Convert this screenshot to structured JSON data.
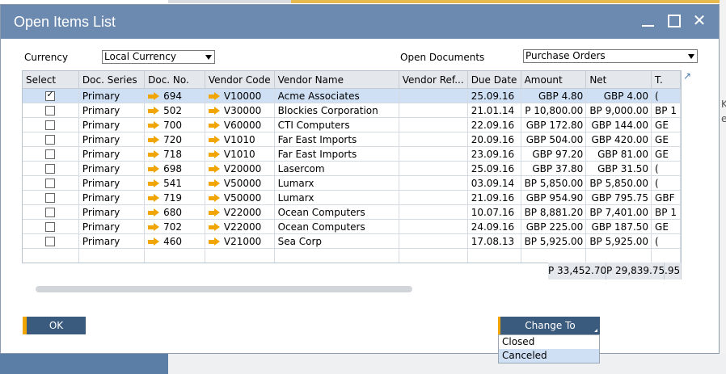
{
  "window": {
    "title": "Open Items List"
  },
  "filters": {
    "currency_label": "Currency",
    "currency_value": "Local Currency",
    "open_documents_label": "Open Documents",
    "open_documents_value": "Purchase Orders"
  },
  "table": {
    "columns": [
      "Select",
      "Doc. Series",
      "Doc. No.",
      "Vendor Code",
      "Vendor Name",
      "Vendor Ref...",
      "Due Date",
      "Amount",
      "Net",
      "T."
    ],
    "rows": [
      {
        "checked": true,
        "series": "Primary",
        "doc_no": "694",
        "vendor_code": "V10000",
        "vendor_name": "Acme Associates",
        "vendor_ref": "",
        "due_date": "25.09.16",
        "amount": "GBP 4.80",
        "net": "GBP 4.00",
        "t": "("
      },
      {
        "checked": false,
        "series": "Primary",
        "doc_no": "502",
        "vendor_code": "V30000",
        "vendor_name": "Blockies Corporation",
        "vendor_ref": "",
        "due_date": "21.01.14",
        "amount": "P 10,800.00",
        "net": "BP 9,000.00",
        "t": "BP 1"
      },
      {
        "checked": false,
        "series": "Primary",
        "doc_no": "700",
        "vendor_code": "V60000",
        "vendor_name": "CTI Computers",
        "vendor_ref": "",
        "due_date": "22.09.16",
        "amount": "GBP 172.80",
        "net": "GBP 144.00",
        "t": "GE"
      },
      {
        "checked": false,
        "series": "Primary",
        "doc_no": "720",
        "vendor_code": "V1010",
        "vendor_name": "Far East Imports",
        "vendor_ref": "",
        "due_date": "20.09.16",
        "amount": "GBP 504.00",
        "net": "GBP 420.00",
        "t": "GE"
      },
      {
        "checked": false,
        "series": "Primary",
        "doc_no": "718",
        "vendor_code": "V1010",
        "vendor_name": "Far East Imports",
        "vendor_ref": "",
        "due_date": "23.09.16",
        "amount": "GBP 97.20",
        "net": "GBP 81.00",
        "t": "GE"
      },
      {
        "checked": false,
        "series": "Primary",
        "doc_no": "698",
        "vendor_code": "V20000",
        "vendor_name": "Lasercom",
        "vendor_ref": "",
        "due_date": "25.09.16",
        "amount": "GBP 37.80",
        "net": "GBP 31.50",
        "t": "("
      },
      {
        "checked": false,
        "series": "Primary",
        "doc_no": "541",
        "vendor_code": "V50000",
        "vendor_name": "Lumarx",
        "vendor_ref": "",
        "due_date": "03.09.14",
        "amount": "BP 5,850.00",
        "net": "BP 5,850.00",
        "t": "("
      },
      {
        "checked": false,
        "series": "Primary",
        "doc_no": "719",
        "vendor_code": "V50000",
        "vendor_name": "Lumarx",
        "vendor_ref": "",
        "due_date": "21.09.16",
        "amount": "GBP 954.90",
        "net": "GBP 795.75",
        "t": "GBF"
      },
      {
        "checked": false,
        "series": "Primary",
        "doc_no": "680",
        "vendor_code": "V22000",
        "vendor_name": "Ocean Computers",
        "vendor_ref": "",
        "due_date": "10.07.16",
        "amount": "BP 8,881.20",
        "net": "BP 7,401.00",
        "t": "BP 1"
      },
      {
        "checked": false,
        "series": "Primary",
        "doc_no": "702",
        "vendor_code": "V22000",
        "vendor_name": "Ocean Computers",
        "vendor_ref": "",
        "due_date": "24.09.16",
        "amount": "GBP 225.00",
        "net": "GBP 187.50",
        "t": "GE"
      },
      {
        "checked": false,
        "series": "Primary",
        "doc_no": "460",
        "vendor_code": "V21000",
        "vendor_name": "Sea Corp",
        "vendor_ref": "",
        "due_date": "17.08.13",
        "amount": "BP 5,925.00",
        "net": "BP 5,925.00",
        "t": "("
      }
    ],
    "totals": {
      "amount": "P 33,452.70",
      "net": "P 29,839.75",
      "t": ".95"
    }
  },
  "buttons": {
    "ok_label": "OK",
    "change_to_label": "Change To"
  },
  "change_menu": {
    "items": [
      "Closed",
      "Canceled"
    ],
    "highlighted_index": 1
  },
  "background": {
    "right_text_1": "K",
    "right_text_2": "e"
  },
  "icons": {
    "link_arrow": "golden-arrow-icon",
    "dropdown": "chevron-down-icon",
    "expand": "expand-icon"
  },
  "colors": {
    "titlebar": "#6c8ab0",
    "button": "#3a5a7e",
    "accent": "#f0a500",
    "selected_row": "#cfe0f5"
  }
}
